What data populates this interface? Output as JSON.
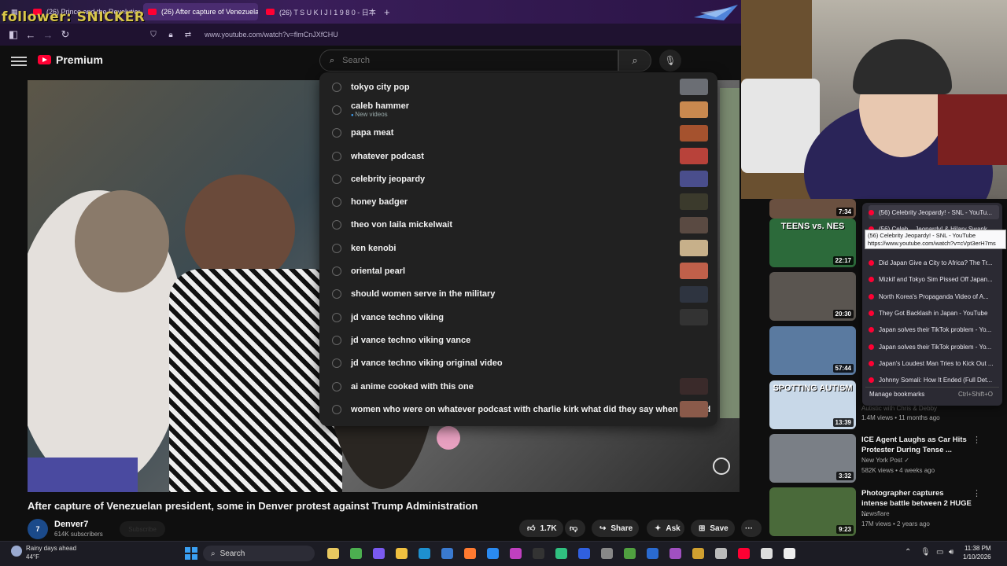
{
  "browser": {
    "tabs": [
      {
        "label": "(26) Prince and the Revolution..."
      },
      {
        "label": "(26) After capture of Venezuela..."
      },
      {
        "label": "(26) T S U K I J I   1 9 8 0 - 日本..."
      }
    ],
    "overlay_text": "follower: SNICKER",
    "url": "www.youtube.com/watch?v=flmCnJXfCHU"
  },
  "youtube": {
    "logo_label": "Premium",
    "search": {
      "placeholder": "Search"
    },
    "suggestions": [
      {
        "text": "tokyo city pop",
        "thumb": "#6b6e74"
      },
      {
        "text": "caleb hammer",
        "sub": "New videos",
        "thumb": "#c9894f"
      },
      {
        "text": "papa meat",
        "thumb": "#a5522e"
      },
      {
        "text": "whatever podcast",
        "thumb": "#b8423a"
      },
      {
        "text": "celebrity jeopardy",
        "thumb": "#4a4e8c"
      },
      {
        "text": "honey badger",
        "thumb": "#3b3a2c"
      },
      {
        "text": "theo von laila mickelwait",
        "thumb": "#5a4a42"
      },
      {
        "text": "ken kenobi",
        "thumb": "#c7b08a"
      },
      {
        "text": "oriental pearl",
        "thumb": "#c0604a"
      },
      {
        "text": "should women serve in the military",
        "thumb": "#2e3440"
      },
      {
        "text": "jd vance techno viking",
        "thumb": "#333333"
      },
      {
        "text": "jd vance techno viking vance"
      },
      {
        "text": "jd vance techno viking original video"
      },
      {
        "text": "ai anime cooked with this one",
        "thumb": "#3a2a2a"
      },
      {
        "text": "women who were on whatever podcast with charlie kirk what did they say when he died",
        "thumb": "#8a5a4a"
      }
    ]
  },
  "video": {
    "title": "After capture of Venezuelan president, some in Denver protest against Trump Administration",
    "channel": "Denver7",
    "subscribers": "614K subscribers",
    "subscribe_label": "Subscribe",
    "likes": "1.7K",
    "share_label": "Share",
    "ask_label": "Ask",
    "save_label": "Save",
    "more_label": "···"
  },
  "sidebar": {
    "recs": [
      {
        "duration": "7:34",
        "thumb": "#6a5040"
      },
      {
        "duration": "22:17",
        "thumb": "#2c6a3a",
        "thumb_text": "TEENS vs. NES"
      },
      {
        "duration": "20:30",
        "thumb": "#5a5550"
      },
      {
        "duration": "57:44",
        "thumb": "#5a7aa0"
      },
      {
        "duration": "13:39",
        "thumb": "#c8d8e8",
        "thumb_text": "SPOTTING AUTISM",
        "meta_partial": "Autistic with Chris & Debby",
        "meta": "1.4M views • 11 months ago"
      },
      {
        "duration": "3:32",
        "thumb": "#7a7f86",
        "title": "ICE Agent Laughs as Car Hits Protester During Tense ...",
        "channel": "New York Post ✓",
        "meta": "582K views • 4 weeks ago"
      },
      {
        "duration": "9:23",
        "thumb": "#4a6a3a",
        "title": "Photographer captures intense battle between 2 HUGE ...",
        "channel": "Newsflare",
        "meta": "17M views • 2 years ago"
      }
    ]
  },
  "bookmarks": {
    "items": [
      "(56) Celebrity Jeopardy! - SNL - YouTu...",
      "(56) Celeb... Jeopardy! & Hilary Swank...",
      "Did Japan Give a City to Africa? The Tr...",
      "Mizkif and Tokyo Sim Pissed Off Japan...",
      "North Korea's Propaganda Video of A...",
      "They Got Backlash in Japan - YouTube",
      "Japan solves their TikTok problem - Yo...",
      "Japan solves their TikTok problem - Yo...",
      "Japan's Loudest Man Tries to Kick Out ...",
      "Johnny Somali: How It Ended (Full Det..."
    ],
    "tooltip_title": "(56) Celebrity Jeopardy! - SNL - YouTube",
    "tooltip_url": "https://www.youtube.com/watch?v=cVpt3erH7ms",
    "manage_label": "Manage bookmarks",
    "manage_shortcut": "Ctrl+Shift+O"
  },
  "taskbar": {
    "weather_line1": "Rainy days ahead",
    "weather_line2": "44°F",
    "search_label": "Search",
    "time": "11:38 PM",
    "date": "1/10/2026"
  }
}
